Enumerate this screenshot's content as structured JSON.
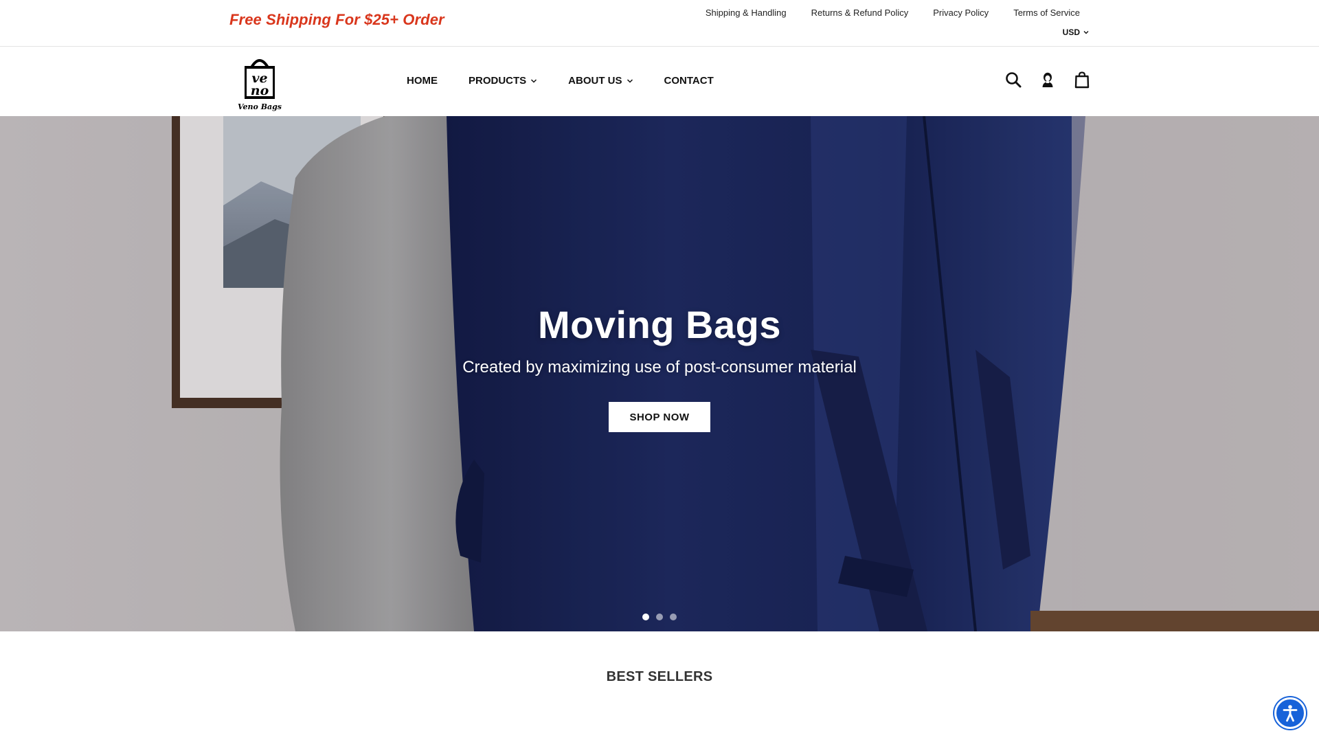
{
  "topbar": {
    "promo": "Free Shipping For $25+ Order",
    "links": [
      "Shipping & Handling",
      "Returns & Refund Policy",
      "Privacy Policy",
      "Terms of Service"
    ],
    "currency": "USD"
  },
  "header": {
    "logo_text": "Veno Bags",
    "logo_mark_top": "ve",
    "logo_mark_bottom": "no",
    "nav": [
      {
        "label": "HOME",
        "has_dropdown": false
      },
      {
        "label": "PRODUCTS",
        "has_dropdown": true
      },
      {
        "label": "ABOUT US",
        "has_dropdown": true
      },
      {
        "label": "CONTACT",
        "has_dropdown": false
      }
    ],
    "icons": [
      "search-icon",
      "account-icon",
      "cart-icon"
    ]
  },
  "hero": {
    "title": "Moving Bags",
    "subtitle": "Created by maximizing use of post-consumer material",
    "button": "SHOP NOW",
    "slides": 3,
    "active_slide": 1
  },
  "best_sellers": {
    "title": "BEST SELLERS"
  },
  "colors": {
    "promo": "#d9361c",
    "accessibility": "#1762d9",
    "bag": "#1e2a5e"
  }
}
